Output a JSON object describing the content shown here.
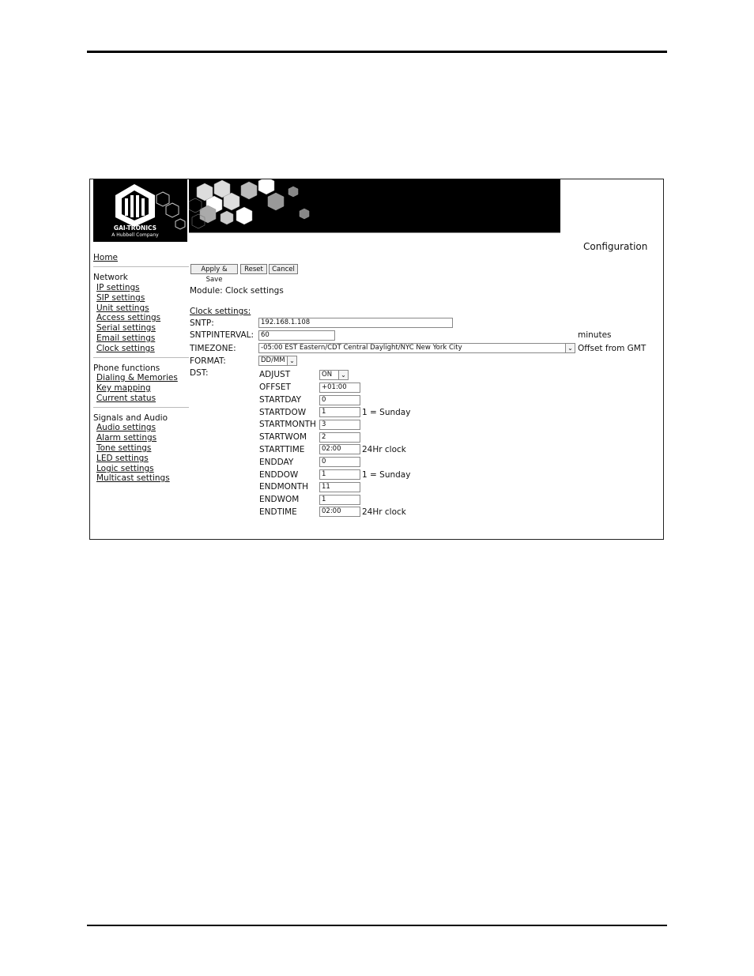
{
  "logo": {
    "company": "GAI-TRONICS",
    "tagline": "A Hubbell Company"
  },
  "page_title": "Configuration",
  "nav": {
    "home": "Home",
    "network": {
      "heading": "Network",
      "items": [
        "IP settings",
        "SIP settings",
        "Unit settings",
        "Access settings",
        "Serial settings",
        "Email settings",
        "Clock settings"
      ]
    },
    "phone": {
      "heading": "Phone functions",
      "items": [
        "Dialing & Memories",
        "Key mapping",
        "Current status"
      ]
    },
    "signals": {
      "heading": "Signals and Audio",
      "items": [
        "Audio settings",
        "Alarm settings",
        "Tone settings",
        "LED settings",
        "Logic settings",
        "Multicast settings"
      ]
    }
  },
  "buttons": {
    "apply": "Apply & Save",
    "reset": "Reset",
    "cancel": "Cancel"
  },
  "module": "Module: Clock settings",
  "section": "Clock settings:",
  "sntp": {
    "label": "SNTP:",
    "value": "192.168.1.108"
  },
  "sntpinterval": {
    "label": "SNTPINTERVAL:",
    "value": "60",
    "unit": "minutes"
  },
  "timezone": {
    "label": "TIMEZONE:",
    "value": "-05:00 EST Eastern/CDT Central Daylight/NYC New York City",
    "note": "Offset from GMT"
  },
  "format": {
    "label": "FORMAT:",
    "value": "DD/MM"
  },
  "dst": {
    "label": "DST:",
    "adjust": {
      "label": "ADJUST",
      "value": "ON"
    },
    "offset": {
      "label": "OFFSET",
      "value": "+01:00"
    },
    "startday": {
      "label": "STARTDAY",
      "value": "0"
    },
    "startdow": {
      "label": "STARTDOW",
      "value": "1",
      "note": "1 = Sunday"
    },
    "startmonth": {
      "label": "STARTMONTH",
      "value": "3"
    },
    "startwom": {
      "label": "STARTWOM",
      "value": "2"
    },
    "starttime": {
      "label": "STARTTIME",
      "value": "02:00",
      "note": "24Hr clock"
    },
    "endday": {
      "label": "ENDDAY",
      "value": "0"
    },
    "enddow": {
      "label": "ENDDOW",
      "value": "1",
      "note": "1 = Sunday"
    },
    "endmonth": {
      "label": "ENDMONTH",
      "value": "11"
    },
    "endwom": {
      "label": "ENDWOM",
      "value": "1"
    },
    "endtime": {
      "label": "ENDTIME",
      "value": "02:00",
      "note": "24Hr clock"
    }
  }
}
